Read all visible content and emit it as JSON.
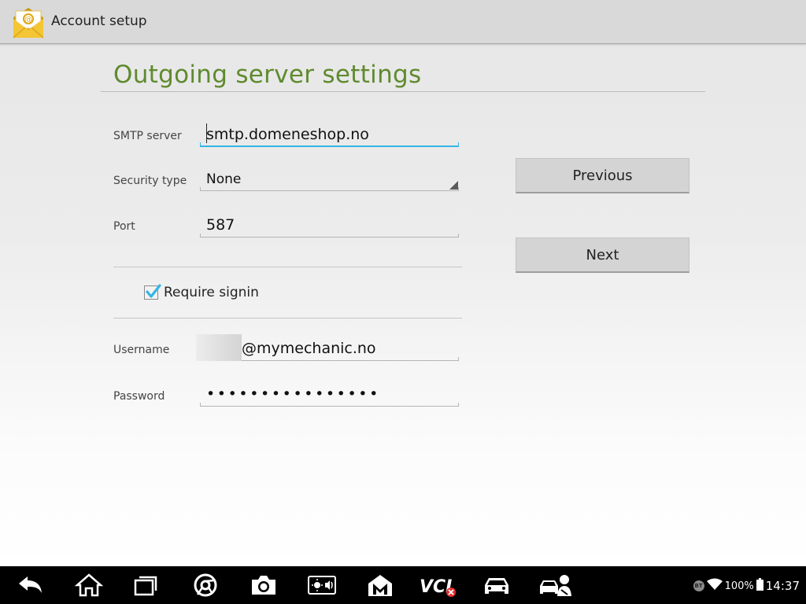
{
  "actionbar": {
    "title": "Account setup",
    "icon": "email-app-icon"
  },
  "page": {
    "title": "Outgoing server settings"
  },
  "form": {
    "smtp": {
      "label": "SMTP server",
      "value": "smtp.domeneshop.no"
    },
    "security": {
      "label": "Security type",
      "value": "None"
    },
    "port": {
      "label": "Port",
      "value": "587"
    },
    "require_signin": {
      "label": "Require signin",
      "checked": true
    },
    "username": {
      "label": "Username",
      "value": "@mymechanic.no"
    },
    "password": {
      "label": "Password",
      "value": "••••••••••••••••"
    }
  },
  "buttons": {
    "previous": "Previous",
    "next": "Next"
  },
  "navbar": {
    "icons": [
      "back-icon",
      "home-icon",
      "recent-apps-icon",
      "chrome-icon",
      "camera-icon",
      "brightness-volume-icon",
      "maxifix-icon",
      "vci-icon",
      "car-icon",
      "mechanic-icon"
    ]
  },
  "status": {
    "bluetooth": "BT",
    "battery": "100%",
    "time": "14:37"
  },
  "colors": {
    "accent": "#33b5e5",
    "title_green": "#5f8a2e"
  }
}
